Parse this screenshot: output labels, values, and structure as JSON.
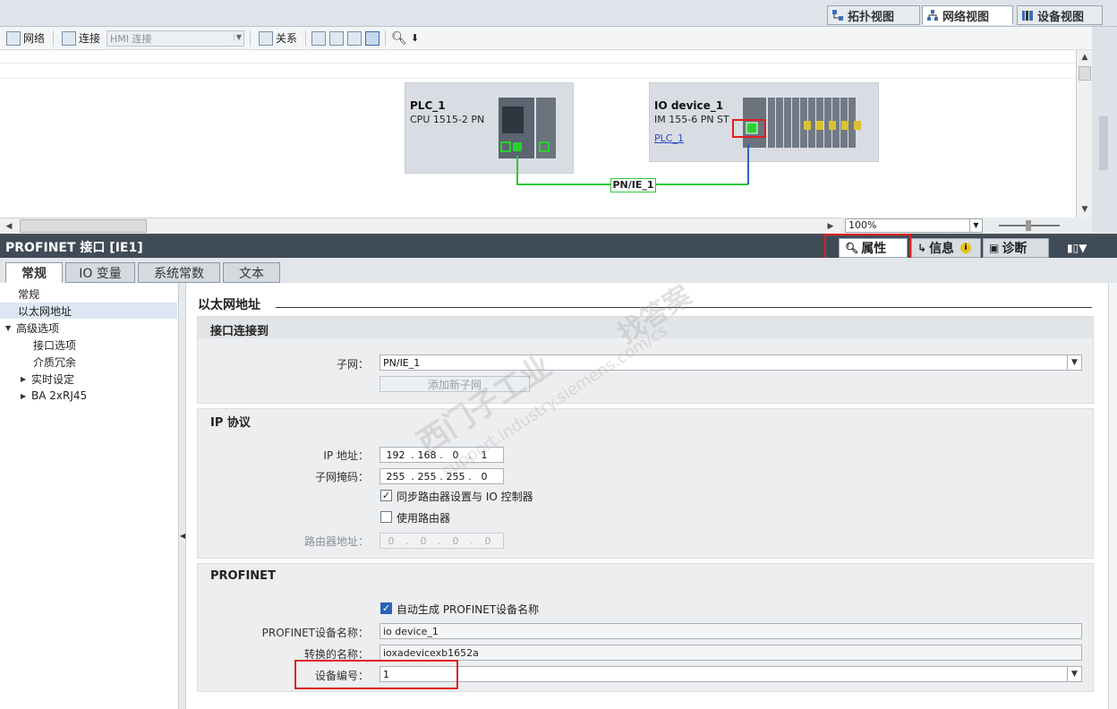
{
  "view_tabs": [
    {
      "label": "拓扑视图",
      "icon": "topology-icon"
    },
    {
      "label": "网络视图",
      "icon": "network-icon"
    },
    {
      "label": "设备视图",
      "icon": "device-icon"
    }
  ],
  "toolbar": {
    "network_label": "网络",
    "connect_label": "连接",
    "hmi_select": "HMI 连接",
    "relation_label": "关系"
  },
  "devices": [
    {
      "name": "PLC_1",
      "type": "CPU 1515-2 PN",
      "link": ""
    },
    {
      "name": "IO device_1",
      "type": "IM 155-6 PN ST",
      "link": "PLC_1"
    }
  ],
  "subnet_label": "PN/IE_1",
  "zoom": "100%",
  "inspector": {
    "title": "PROFINET 接口 [IE1]",
    "tabs": [
      "属性",
      "信息",
      "诊断"
    ]
  },
  "section_tabs": [
    "常规",
    "IO 变量",
    "系统常数",
    "文本"
  ],
  "tree": [
    {
      "label": "常规",
      "indent": 0,
      "arrow": ""
    },
    {
      "label": "以太网地址",
      "indent": 0,
      "arrow": ""
    },
    {
      "label": "高级选项",
      "indent": 0,
      "arrow": "▼"
    },
    {
      "label": "接口选项",
      "indent": 1,
      "arrow": ""
    },
    {
      "label": "介质冗余",
      "indent": 1,
      "arrow": ""
    },
    {
      "label": "实时设定",
      "indent": 1,
      "arrow": "▶"
    },
    {
      "label": "BA 2xRJ45",
      "indent": 1,
      "arrow": "▶"
    }
  ],
  "content": {
    "heading": "以太网地址",
    "iface": {
      "title": "接口连接到",
      "subnet_label": "子网：",
      "subnet_value": "PN/IE_1",
      "add_subnet": "添加新子网"
    },
    "ip": {
      "title": "IP 协议",
      "ip_label": "IP 地址：",
      "ip_value": [
        "192",
        "168",
        "0",
        "1"
      ],
      "mask_label": "子网掩码：",
      "mask_value": [
        "255",
        "255",
        "255",
        "0"
      ],
      "sync_router": "同步路由器设置与 IO 控制器",
      "use_router": "使用路由器",
      "router_label": "路由器地址：",
      "router_value": [
        "0",
        "0",
        "0",
        "0"
      ]
    },
    "profinet": {
      "title": "PROFINET",
      "auto_name": "自动生成 PROFINET设备名称",
      "name_label": "PROFINET设备名称：",
      "name_value": "io device_1",
      "conv_label": "转换的名称：",
      "conv_value": "ioxadevicexb1652a",
      "num_label": "设备编号：",
      "num_value": "1"
    }
  },
  "watermark": [
    "西门子工业",
    "找答案",
    "support.industry.siemens.com/cs"
  ]
}
